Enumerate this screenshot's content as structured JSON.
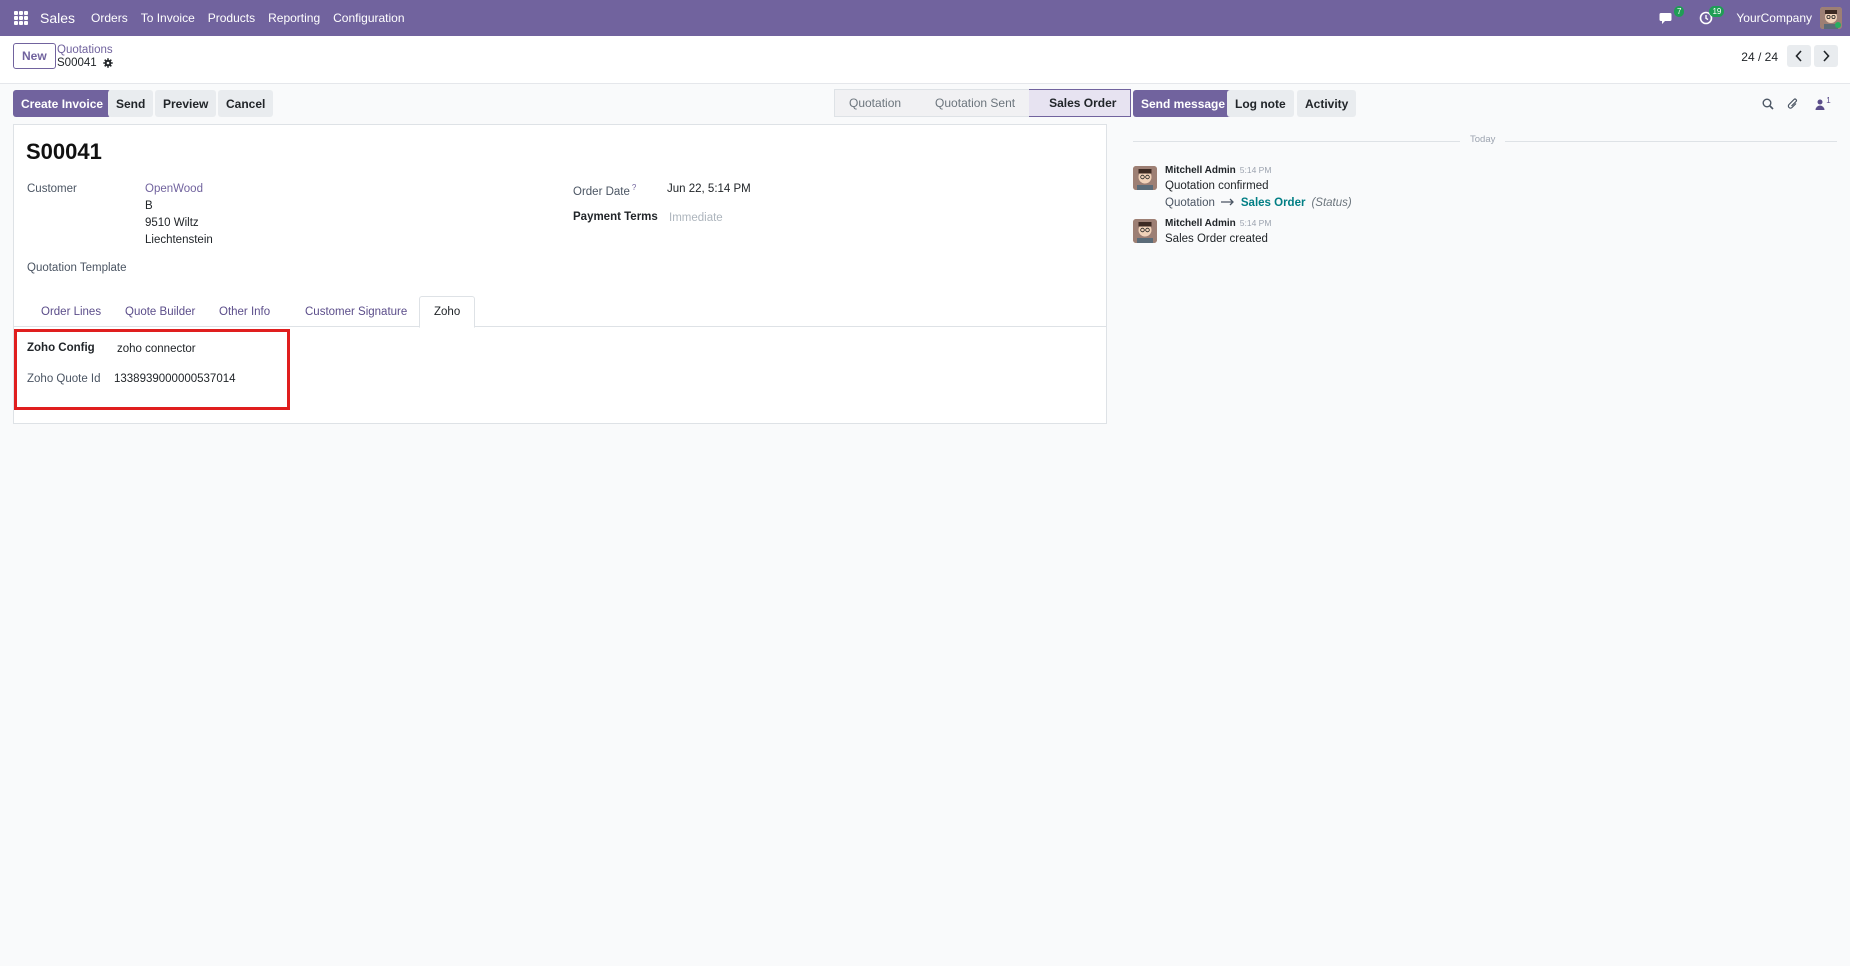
{
  "navbar": {
    "app_name": "Sales",
    "menu": [
      "Orders",
      "To Invoice",
      "Products",
      "Reporting",
      "Configuration"
    ],
    "messages_count": "7",
    "activities_count": "19",
    "company": "YourCompany"
  },
  "control_panel": {
    "new_label": "New",
    "breadcrumb_parent": "Quotations",
    "breadcrumb_current": "S00041",
    "pager": "24 / 24"
  },
  "actions": {
    "create_invoice": "Create Invoice",
    "send": "Send",
    "preview": "Preview",
    "cancel": "Cancel"
  },
  "statusbar": {
    "steps": [
      "Quotation",
      "Quotation Sent",
      "Sales Order"
    ],
    "active": "Sales Order"
  },
  "form": {
    "title": "S00041",
    "customer_label": "Customer",
    "customer_name": "OpenWood",
    "customer_address": [
      "B",
      "9510 Wiltz",
      "Liechtenstein"
    ],
    "quotation_template_label": "Quotation Template",
    "order_date_label": "Order Date",
    "order_date_help": "?",
    "order_date_value": "Jun 22, 5:14 PM",
    "payment_terms_label": "Payment Terms",
    "payment_terms_placeholder": "Immediate",
    "tabs": [
      "Order Lines",
      "Quote Builder",
      "Other Info",
      "Customer Signature",
      "Zoho"
    ],
    "active_tab": "Zoho",
    "zoho_config_label": "Zoho Config",
    "zoho_config_value": "zoho connector",
    "zoho_quote_id_label": "Zoho Quote Id",
    "zoho_quote_id_value": "1338939000000537014"
  },
  "chatter": {
    "send_message": "Send message",
    "log_note": "Log note",
    "activity": "Activity",
    "followers_count": "1",
    "today_label": "Today",
    "messages": [
      {
        "author": "Mitchell Admin",
        "time": "5:14 PM",
        "text": "Quotation confirmed",
        "tracking": {
          "old": "Quotation",
          "new": "Sales Order",
          "field": "(Status)"
        }
      },
      {
        "author": "Mitchell Admin",
        "time": "5:14 PM",
        "text": "Sales Order created"
      }
    ]
  },
  "colors": {
    "brand": "#71639e",
    "highlight": "#e01e1e",
    "tracking_link": "#017e84"
  }
}
